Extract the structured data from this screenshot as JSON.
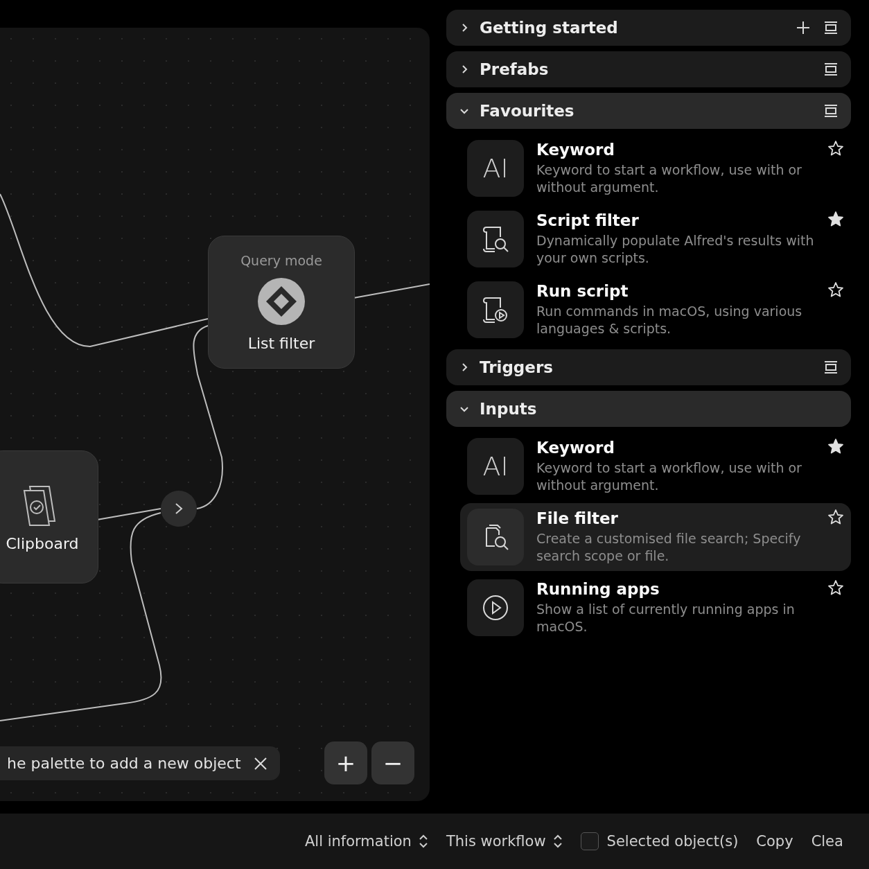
{
  "canvas": {
    "nodes": [
      {
        "kind": "list_filter",
        "caption": "Query mode",
        "label": "List filter"
      },
      {
        "kind": "clipboard",
        "label": "Clipboard"
      }
    ],
    "hint": {
      "text": "he palette to add a new object"
    },
    "zoom_buttons": [
      "+",
      "−"
    ]
  },
  "palette": {
    "sections": [
      {
        "title": "Getting started",
        "expanded": false,
        "add_button": true,
        "collapse_button": true
      },
      {
        "title": "Prefabs",
        "expanded": false,
        "collapse_button": true
      },
      {
        "title": "Favourites",
        "expanded": true,
        "collapse_button": true,
        "items": [
          {
            "kind": "keyword",
            "glyph": "AI",
            "title": "Keyword",
            "description": "Keyword to start a workflow, use with or without argument.",
            "starred": false,
            "selected": false
          },
          {
            "kind": "script_filter",
            "title": "Script filter",
            "description": "Dynamically populate Alfred's results with your own scripts.",
            "starred": true,
            "selected": false
          },
          {
            "kind": "run_script",
            "title": "Run script",
            "description": "Run commands in macOS, using various languages & scripts.",
            "starred": false,
            "selected": false
          }
        ]
      },
      {
        "title": "Triggers",
        "expanded": false,
        "collapse_button": true
      },
      {
        "title": "Inputs",
        "expanded": true,
        "items": [
          {
            "kind": "keyword",
            "glyph": "AI",
            "title": "Keyword",
            "description": "Keyword to start a workflow, use with or without argument.",
            "starred": true,
            "selected": false
          },
          {
            "kind": "file_filter",
            "title": "File filter",
            "description": "Create a customised file search; Specify search scope or file.",
            "starred": false,
            "selected": true
          },
          {
            "kind": "running_apps",
            "title": "Running apps",
            "description": "Show a list of currently running apps in macOS.",
            "starred": false,
            "selected": false
          }
        ]
      }
    ]
  },
  "status_bar": {
    "selectors": [
      "All information",
      "This workflow"
    ],
    "checkbox": {
      "label": "Selected object(s)",
      "checked": false
    },
    "actions": [
      "Copy",
      "Clea"
    ]
  }
}
